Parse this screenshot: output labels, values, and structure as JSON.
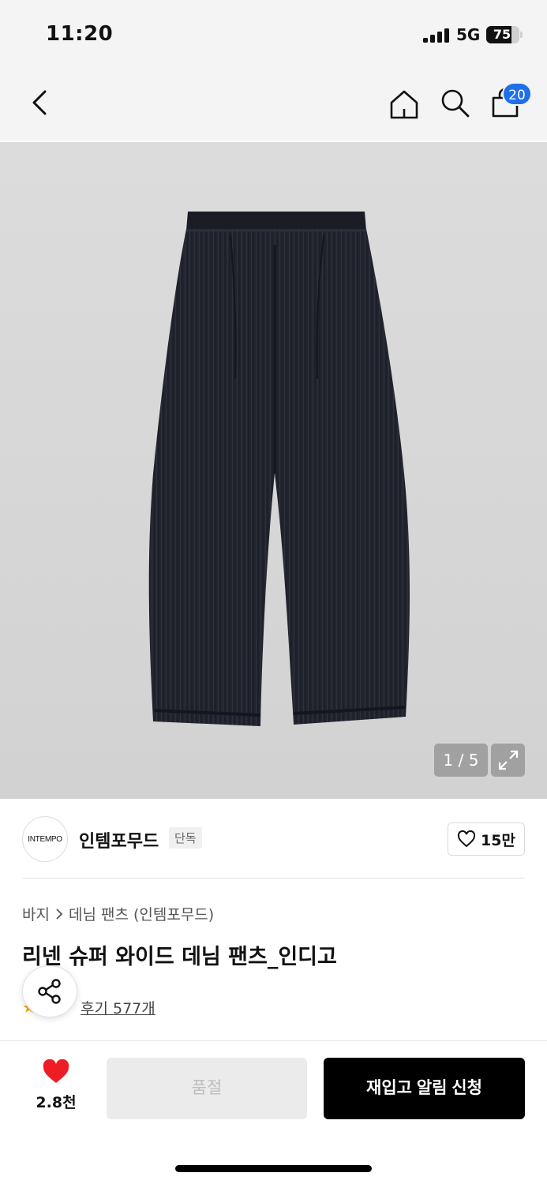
{
  "status_bar": {
    "time": "11:20",
    "network": "5G",
    "battery_level": "75",
    "battery_percent": 75
  },
  "nav": {
    "back_icon": "chevron-left-icon",
    "home_icon": "home-icon",
    "search_icon": "search-icon",
    "cart_icon": "shopping-bag-icon",
    "cart_count": "20",
    "badge_color": "#1f6fe8"
  },
  "gallery": {
    "counter": "1 / 5",
    "expand_icon": "expand-icon"
  },
  "brand": {
    "logo_text": "INTEMPO",
    "name": "인템포무드",
    "tag": "단독",
    "like_count": "15만",
    "like_icon": "heart-outline-icon"
  },
  "product": {
    "breadcrumb": [
      "바지",
      "데님 팬츠 (인템포무드)"
    ],
    "title": "리넨 슈퍼 와이드 데님 팬츠_인디고",
    "rating_stars": "★★★",
    "review_link": "후기 577개",
    "share_icon": "share-icon"
  },
  "bottom_bar": {
    "wish_icon": "heart-filled-icon",
    "wish_color": "#ee1c25",
    "wish_count": "2.8천",
    "soldout_label": "품절",
    "restock_label": "재입고 알림 신청"
  }
}
